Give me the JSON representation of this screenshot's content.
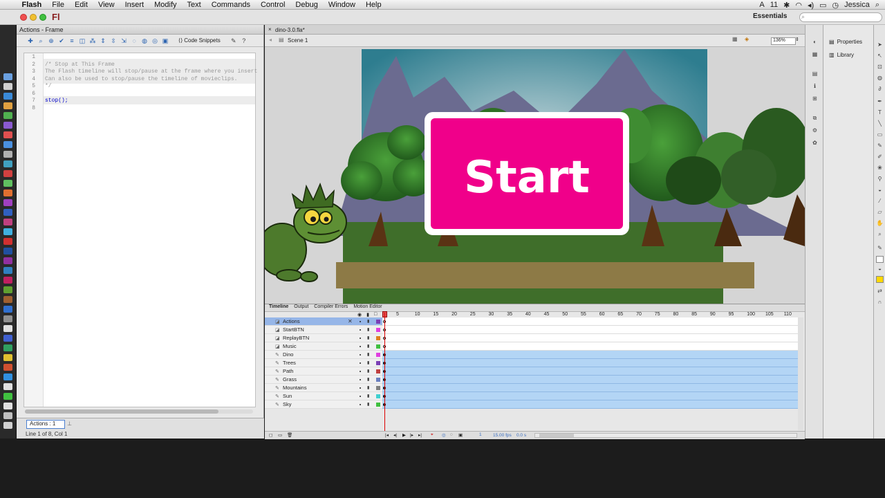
{
  "menubar": {
    "app_name": "Flash",
    "items": [
      "File",
      "Edit",
      "View",
      "Insert",
      "Modify",
      "Text",
      "Commands",
      "Control",
      "Debug",
      "Window",
      "Help"
    ],
    "status_time": "11",
    "user": "Jessica"
  },
  "appbar": {
    "logo": "Fl",
    "workspace": "Essentials",
    "search_placeholder": ""
  },
  "actions_panel": {
    "title": "Actions - Frame",
    "code_snippets_label": "Code Snippets",
    "lines": [
      {
        "n": "1",
        "text": ""
      },
      {
        "n": "2",
        "text": "/* Stop at This Frame"
      },
      {
        "n": "3",
        "text": "The Flash timeline will stop/pause at the frame where you insert"
      },
      {
        "n": "4",
        "text": "Can also be used to stop/pause the timeline of movieclips."
      },
      {
        "n": "5",
        "text": "*/"
      },
      {
        "n": "6",
        "text": ""
      },
      {
        "n": "7",
        "text": "stop();"
      },
      {
        "n": "8",
        "text": ""
      }
    ],
    "tab_label": "Actions : 1",
    "status": "Line 1 of 8, Col 1"
  },
  "document": {
    "tab": "dino-3.0.fla*",
    "scene": "Scene 1",
    "zoom": "136%",
    "start_button_text": "Start"
  },
  "timeline": {
    "tabs": [
      "Timeline",
      "Output",
      "Compiler Errors",
      "Motion Editor"
    ],
    "frame_numbers": [
      "5",
      "10",
      "15",
      "20",
      "25",
      "30",
      "35",
      "40",
      "45",
      "50",
      "55",
      "60",
      "65",
      "70",
      "75",
      "80",
      "85",
      "90",
      "95",
      "100",
      "105",
      "110"
    ],
    "layers": [
      {
        "name": "Actions",
        "color": "#7b3fb5",
        "selected": true,
        "filled": false
      },
      {
        "name": "StartBTN",
        "color": "#e040e0",
        "selected": false,
        "filled": false
      },
      {
        "name": "ReplayBTN",
        "color": "#e08020",
        "selected": false,
        "filled": false
      },
      {
        "name": "Music",
        "color": "#40c040",
        "selected": false,
        "filled": false
      },
      {
        "name": "Dino",
        "color": "#e040e0",
        "selected": false,
        "filled": true
      },
      {
        "name": "Trees",
        "color": "#7b3fb5",
        "selected": false,
        "filled": true
      },
      {
        "name": "Path",
        "color": "#c04040",
        "selected": false,
        "filled": true
      },
      {
        "name": "Grass",
        "color": "#6a7fc0",
        "selected": false,
        "filled": true
      },
      {
        "name": "Mountains",
        "color": "#808080",
        "selected": false,
        "filled": true
      },
      {
        "name": "Sun",
        "color": "#40d0d0",
        "selected": false,
        "filled": true
      },
      {
        "name": "Sky",
        "color": "#40c040",
        "selected": false,
        "filled": true
      }
    ],
    "fps": "15.00 fps",
    "time": "0.0 s",
    "current_frame": "1"
  },
  "right_panel": {
    "properties": "Properties",
    "library": "Library"
  }
}
